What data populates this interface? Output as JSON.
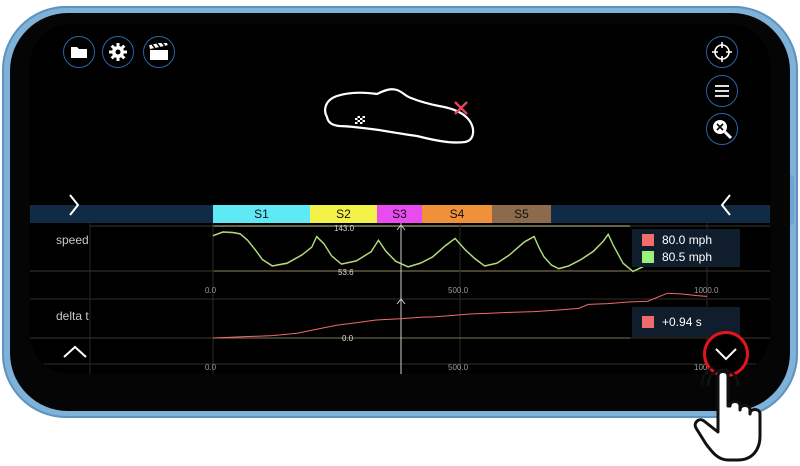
{
  "toolbar": {
    "left_icons": [
      "folder-icon",
      "gear-icon",
      "clapperboard-icon"
    ],
    "right_icons": [
      "crosshair-icon",
      "menu-icon",
      "zoom-fit-icon"
    ]
  },
  "track": {
    "start_icon": "checkered-flag-icon",
    "position_marker_icon": "x-marker-icon",
    "outline_color": "#ffffff",
    "marker_color": "#e0465a"
  },
  "sectors": [
    {
      "label": "S1",
      "color": "#5fe9f5"
    },
    {
      "label": "S2",
      "color": "#f4f248"
    },
    {
      "label": "S3",
      "color": "#e84cf0"
    },
    {
      "label": "S4",
      "color": "#f0913a"
    },
    {
      "label": "S5",
      "color": "#8d6a4c"
    }
  ],
  "speed_plot": {
    "label": "speed",
    "y_max_label": "143.0",
    "y_min_label": "53.6",
    "x_ticks": [
      "0.0",
      "500.0",
      "1000.0"
    ],
    "legend": [
      {
        "value": "80.0 mph",
        "color": "#f06b6b"
      },
      {
        "value": "80.5 mph",
        "color": "#9af07a"
      }
    ]
  },
  "delta_plot": {
    "label": "delta t",
    "y_zero_label": "0.0",
    "x_ticks": [
      "0.0",
      "500.0",
      "1000.0"
    ],
    "legend": [
      {
        "value": "+0.94 s",
        "color": "#f06b6b"
      }
    ]
  },
  "chart_data": [
    {
      "type": "line",
      "xlim": [
        0,
        1000
      ],
      "ylim": [
        53.6,
        143.0
      ],
      "series": [
        {
          "color": "#f06b6b",
          "x": [
            0,
            20,
            40,
            55,
            70,
            85,
            100,
            120,
            150,
            180,
            200,
            210,
            225,
            240,
            260,
            290,
            320,
            335,
            350,
            370,
            395,
            420,
            445,
            470,
            490,
            510,
            530,
            550,
            575,
            600,
            630,
            650,
            660,
            670,
            685,
            700,
            720,
            745,
            770,
            790,
            800,
            810,
            830,
            850,
            870,
            900
          ],
          "y": [
            130,
            138,
            137,
            134,
            120,
            100,
            78,
            64,
            70,
            88,
            105,
            128,
            112,
            86,
            68,
            75,
            95,
            120,
            96,
            74,
            62,
            70,
            84,
            108,
            124,
            100,
            80,
            64,
            70,
            88,
            116,
            128,
            104,
            84,
            66,
            58,
            64,
            78,
            96,
            118,
            133,
            110,
            70,
            52,
            62,
            88
          ]
        },
        {
          "color": "#9af07a",
          "x": [
            0,
            20,
            40,
            55,
            70,
            85,
            100,
            120,
            150,
            180,
            200,
            210,
            225,
            240,
            260,
            290,
            320,
            335,
            350,
            370,
            395,
            420,
            445,
            470,
            490,
            510,
            530,
            550,
            575,
            600,
            630,
            650,
            660,
            670,
            685,
            700,
            720,
            745,
            770,
            790,
            800,
            810,
            830,
            850,
            870,
            900,
            930,
            950,
            970
          ],
          "y": [
            131,
            139,
            138,
            135,
            121,
            101,
            79,
            65,
            71,
            89,
            106,
            129,
            113,
            87,
            69,
            76,
            96,
            121,
            97,
            75,
            63,
            71,
            85,
            109,
            125,
            101,
            81,
            65,
            71,
            89,
            117,
            129,
            105,
            85,
            67,
            59,
            65,
            79,
            97,
            119,
            134,
            111,
            71,
            53,
            63,
            89,
            105,
            115,
            124
          ]
        }
      ]
    },
    {
      "type": "line",
      "xlim": [
        0,
        1000
      ],
      "series": [
        {
          "color": "#f06b6b",
          "x": [
            0,
            60,
            120,
            170,
            210,
            250,
            290,
            330,
            380,
            420,
            450,
            480,
            520,
            560,
            600,
            650,
            700,
            740,
            760,
            800,
            840,
            880,
            920,
            950,
            980,
            1000
          ],
          "y": [
            0.0,
            0.03,
            0.06,
            0.12,
            0.22,
            0.32,
            0.38,
            0.45,
            0.48,
            0.52,
            0.53,
            0.56,
            0.6,
            0.62,
            0.64,
            0.66,
            0.7,
            0.74,
            0.84,
            0.86,
            0.9,
            0.92,
            1.12,
            1.1,
            1.06,
            1.04
          ]
        }
      ]
    }
  ]
}
